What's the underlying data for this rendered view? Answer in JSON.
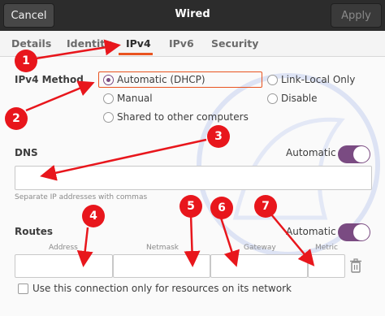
{
  "header": {
    "cancel": "Cancel",
    "title": "Wired",
    "apply": "Apply"
  },
  "tabs": [
    "Details",
    "Identity",
    "IPv4",
    "IPv6",
    "Security"
  ],
  "active_tab": "IPv4",
  "ipv4_method": {
    "label": "IPv4 Method",
    "options": [
      "Automatic (DHCP)",
      "Link-Local Only",
      "Manual",
      "Disable",
      "Shared to other computers"
    ],
    "selected": "Automatic (DHCP)"
  },
  "dns": {
    "label": "DNS",
    "automatic_label": "Automatic",
    "automatic_on": true,
    "value": "",
    "hint": "Separate IP addresses with commas"
  },
  "routes": {
    "label": "Routes",
    "automatic_label": "Automatic",
    "automatic_on": true,
    "columns": [
      "Address",
      "Netmask",
      "Gateway",
      "Metric"
    ]
  },
  "only_resources_label": "Use this connection only for resources on its network",
  "annotations": [
    "1",
    "2",
    "3",
    "4",
    "5",
    "6",
    "7"
  ],
  "colors": {
    "accent": "#e95420",
    "toggle": "#7a4b82",
    "annotation": "#e8161c"
  }
}
